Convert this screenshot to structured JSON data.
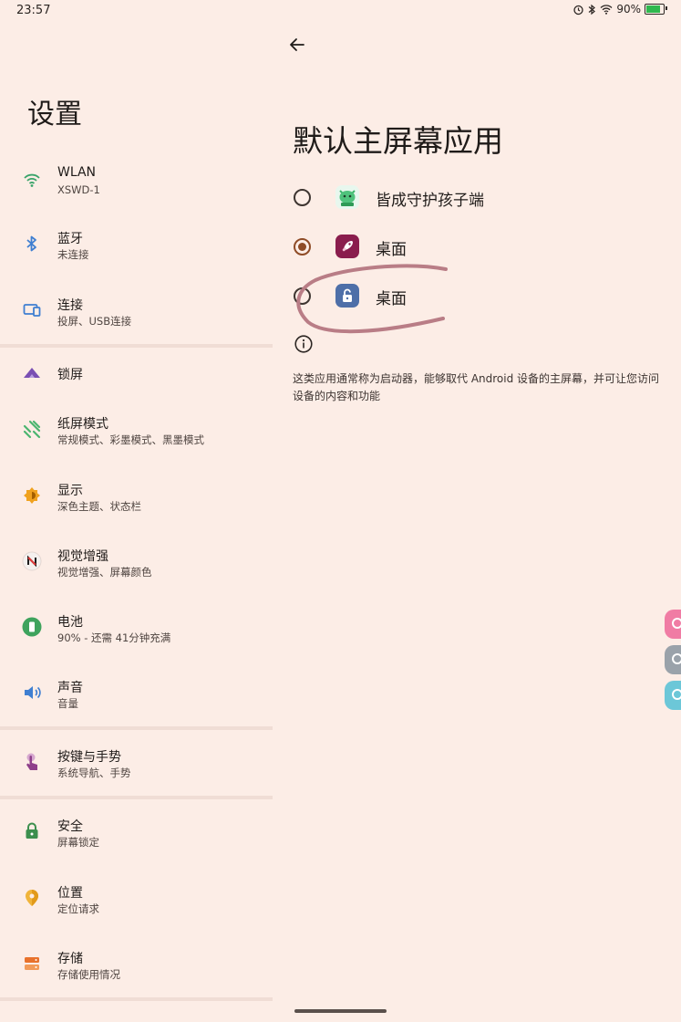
{
  "status_bar": {
    "time": "23:57",
    "battery": "90%",
    "battery_level": 0.9
  },
  "left": {
    "title": "设置",
    "items": [
      {
        "label": "WLAN",
        "sub": "XSWD-1",
        "icon": "wifi-icon"
      },
      {
        "label": "蓝牙",
        "sub": "未连接",
        "icon": "bluetooth-icon"
      },
      {
        "label": "连接",
        "sub": "投屏、USB连接",
        "icon": "connection-icon"
      },
      {
        "label": "锁屏",
        "sub": "",
        "icon": "lockscreen-icon"
      },
      {
        "label": "纸屏模式",
        "sub": "常规模式、彩墨模式、黑墨模式",
        "icon": "paper-mode-icon"
      },
      {
        "label": "显示",
        "sub": "深色主题、状态栏",
        "icon": "display-icon"
      },
      {
        "label": "视觉增强",
        "sub": "视觉增强、屏幕颜色",
        "icon": "visual-enhance-icon"
      },
      {
        "label": "电池",
        "sub": "90% - 还需 41分钟充满",
        "icon": "battery-icon"
      },
      {
        "label": "声音",
        "sub": "音量",
        "icon": "sound-icon"
      },
      {
        "label": "按键与手势",
        "sub": "系统导航、手势",
        "icon": "gesture-icon"
      },
      {
        "label": "安全",
        "sub": "屏幕锁定",
        "icon": "security-icon"
      },
      {
        "label": "位置",
        "sub": "定位请求",
        "icon": "location-icon"
      },
      {
        "label": "存储",
        "sub": "存储使用情况",
        "icon": "storage-icon"
      }
    ]
  },
  "right": {
    "title": "默认主屏幕应用",
    "options": [
      {
        "label": "皆成守护孩子端",
        "selected": false,
        "icon": "guardian-app-icon"
      },
      {
        "label": "桌面",
        "selected": true,
        "icon": "rocket-launcher-icon"
      },
      {
        "label": "桌面",
        "selected": false,
        "icon": "lock-launcher-icon"
      }
    ],
    "description": "这类应用通常称为启动器，能够取代 Android 设备的主屏幕，并可让您访问设备的内容和功能"
  },
  "colors": {
    "background": "#fcede6",
    "accent": "#8f4c27",
    "annotation": "#b97d86"
  }
}
